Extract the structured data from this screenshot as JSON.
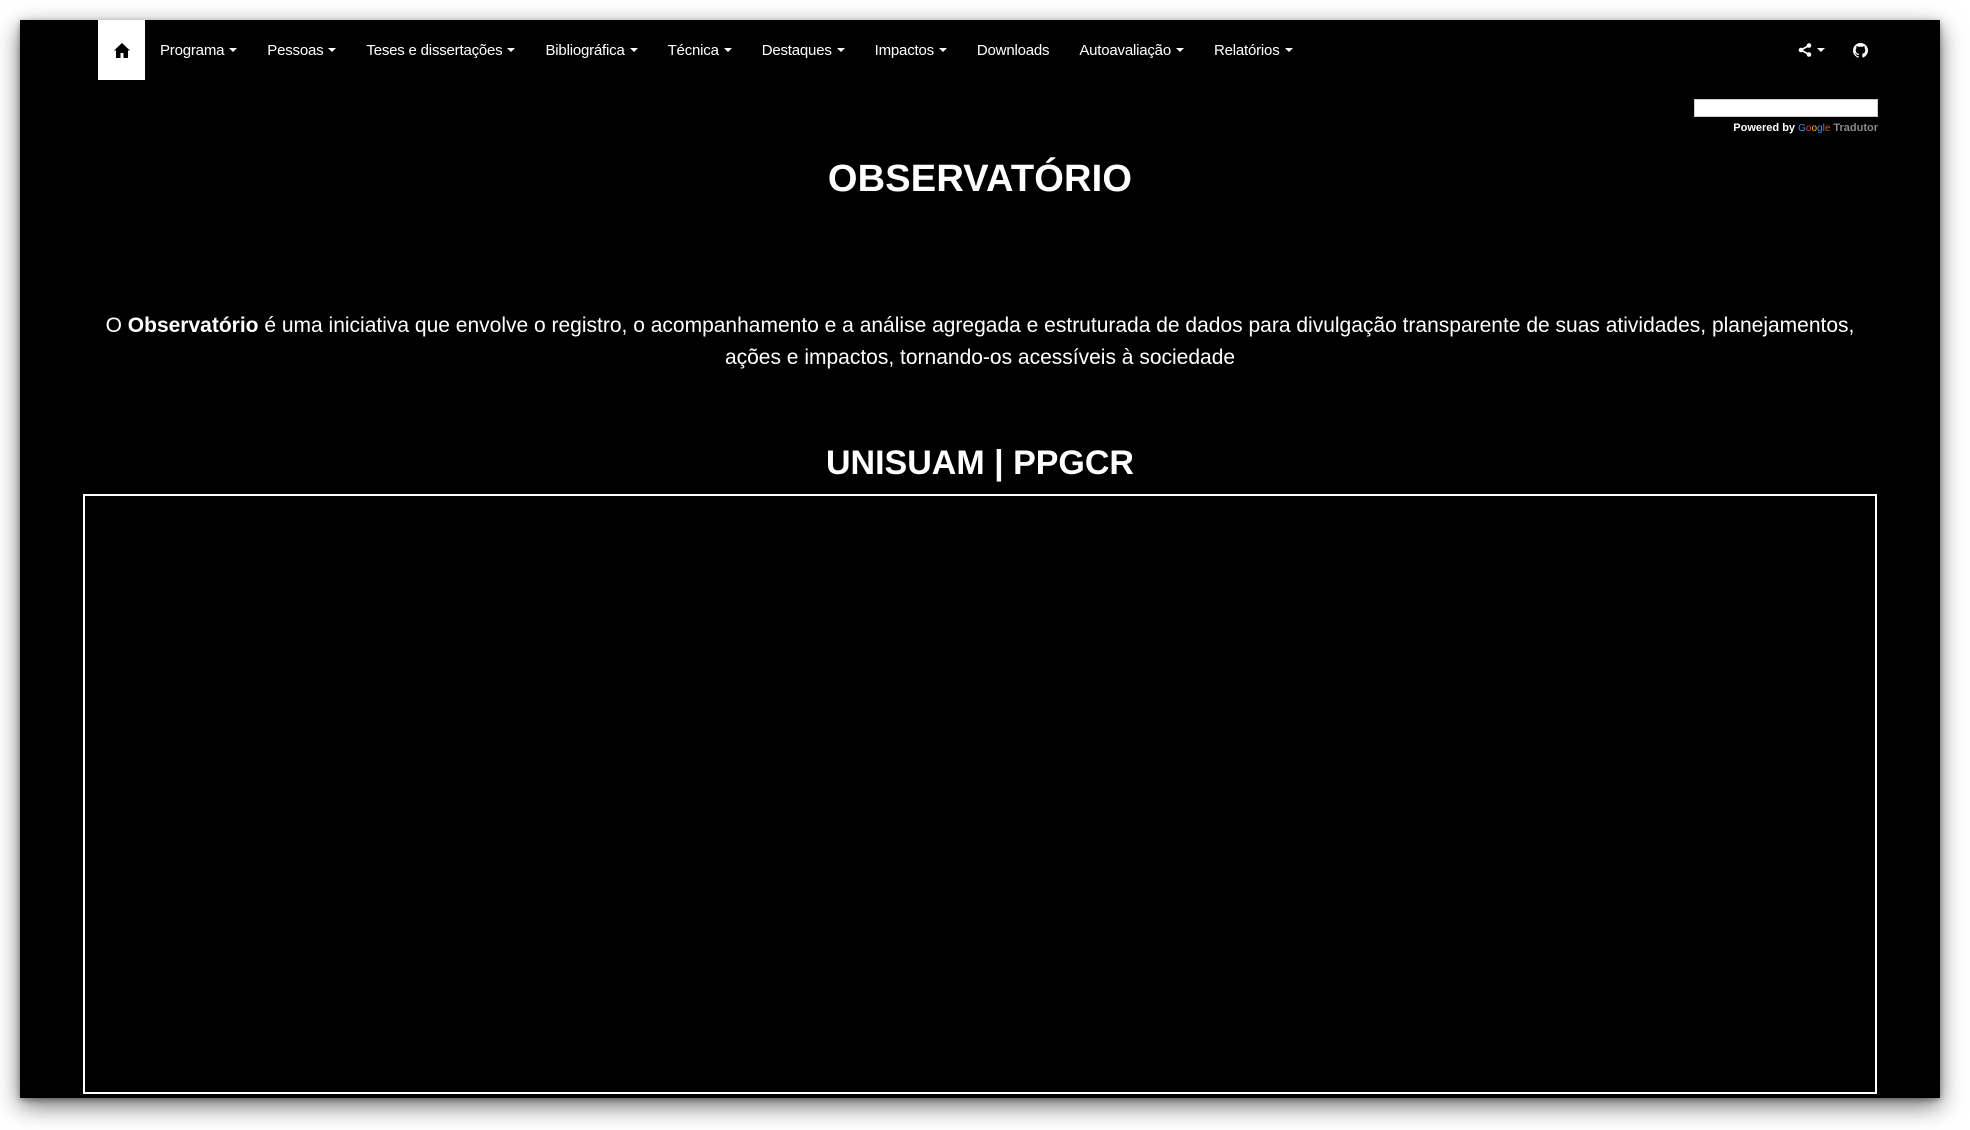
{
  "navbar": {
    "home_icon": "home-icon",
    "items": [
      {
        "label": "Programa",
        "dropdown": true
      },
      {
        "label": "Pessoas",
        "dropdown": true
      },
      {
        "label": "Teses e dissertações",
        "dropdown": true
      },
      {
        "label": "Bibliográfica",
        "dropdown": true
      },
      {
        "label": "Técnica",
        "dropdown": true
      },
      {
        "label": "Destaques",
        "dropdown": true
      },
      {
        "label": "Impactos",
        "dropdown": true
      },
      {
        "label": "Downloads",
        "dropdown": false
      },
      {
        "label": "Autoavaliação",
        "dropdown": true
      },
      {
        "label": "Relatórios",
        "dropdown": true
      }
    ],
    "right_icons": [
      "share-icon",
      "github-icon"
    ]
  },
  "translate": {
    "powered_by": "Powered by",
    "google": "Google",
    "tradutor": "Tradutor"
  },
  "main": {
    "title": "OBSERVATÓRIO",
    "intro_prefix": "O",
    "intro_bold": "Observatório",
    "intro_text": "é uma iniciativa que envolve o registro, o acompanhamento e a análise agregada e estruturada de dados para divulgação transparente de suas atividades, planejamentos, ações e impactos, tornando-os acessíveis à sociedade",
    "section_title": "UNISUAM | PPGCR"
  },
  "colors": {
    "background": "#000000",
    "text": "#ffffff",
    "home_button_bg": "#ffffff"
  }
}
